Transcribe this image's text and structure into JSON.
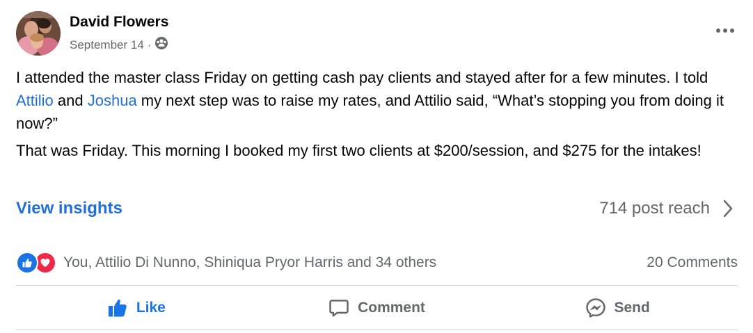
{
  "post": {
    "author": "David Flowers",
    "date": "September 14",
    "separator": "·",
    "audience_icon": "friends-icon",
    "paragraph1": {
      "before": "I attended the master class Friday on getting cash pay clients and stayed after for a few minutes. I told ",
      "mention1": "Attilio",
      "middle": " and ",
      "mention2": "Joshua",
      "after": " my next step was to raise my rates, and Attilio said, “What’s stopping you from doing it now?”"
    },
    "paragraph2": "That was Friday. This morning I booked my first two clients at $200/session, and $275 for the intakes!"
  },
  "insights": {
    "label": "View insights",
    "reach": "714 post reach"
  },
  "reactions": {
    "names": "You, Attilio Di Nunno, Shiniqua Pryor Harris and 34 others",
    "comments": "20 Comments",
    "icons": [
      "like-reaction-icon",
      "love-reaction-icon"
    ]
  },
  "actions": {
    "like": "Like",
    "comment": "Comment",
    "send": "Send"
  },
  "colors": {
    "accent": "#216fdb",
    "like_blue": "#1b74e4",
    "love_red": "#f0284a",
    "secondary_text": "#65676b"
  }
}
